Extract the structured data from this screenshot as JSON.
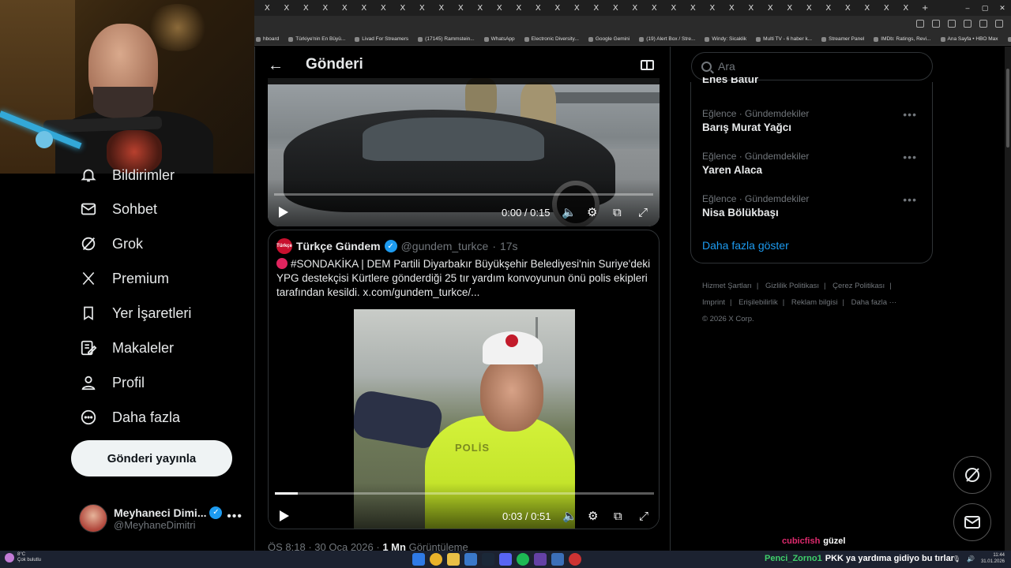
{
  "browser": {
    "tab_close_glyph": "X",
    "tab_count": 34,
    "window_controls": [
      "–",
      "▢",
      "✕"
    ],
    "new_tab": "+",
    "bookmarks": [
      "hboard",
      "Türkiye'nin En Büyü...",
      "Livad For Streamers",
      "(17145) Rammstein...",
      "WhatsApp",
      "Electronic Diversity...",
      "Google Gemini",
      "(19) Alert Box / Stre...",
      "Windy: Sicaklik",
      "Multi TV - 6 haber k...",
      "Streamer Panel",
      "IMDb: Ratings, Revi...",
      "Ana Sayfa • HBO Max",
      "»",
      "Tüm Yer İşaretleri"
    ]
  },
  "nav": {
    "items": [
      {
        "label": "Bildirimler",
        "icon": "bell-icon"
      },
      {
        "label": "Sohbet",
        "icon": "mail-icon"
      },
      {
        "label": "Grok",
        "icon": "grok-icon"
      },
      {
        "label": "Premium",
        "icon": "x-logo-icon"
      },
      {
        "label": "Yer İşaretleri",
        "icon": "bookmark-icon"
      },
      {
        "label": "Makaleler",
        "icon": "article-icon"
      },
      {
        "label": "Profil",
        "icon": "person-icon"
      },
      {
        "label": "Daha fazla",
        "icon": "more-circle-icon"
      }
    ],
    "post_button": "Gönderi yayınla",
    "profile": {
      "name": "Meyhaneci Dimi...",
      "handle": "@MeyhaneDimitri",
      "more": "•••",
      "avatar_label": "DİMİTRİ"
    }
  },
  "post": {
    "header_title": "Gönderi",
    "video1": {
      "time": "0:00 / 0:15",
      "progress": 0.0
    },
    "quote": {
      "avatar_label": "Türkçe",
      "name": "Türkçe Gündem",
      "handle": "@gundem_turkce",
      "dot": "·",
      "age": "17s",
      "text": "#SONDAKİKA | DEM Partili Diyarbakır Büyükşehir Belediyesi'nin Suriye'deki YPG destekçisi Kürtlere gönderdiği 25 tır yardım konvoyunun önü polis ekipleri tarafından kesildi.  x.com/gundem_turkce/...",
      "video_time": "0:03 / 0:51",
      "video_progress": 0.06,
      "video_overlay_text": "POLİS"
    },
    "meta": {
      "time": "ÖS 8:18",
      "sep": "·",
      "date": "30 Oca 2026",
      "views": "1 Mn",
      "views_label": "Görüntüleme"
    }
  },
  "sidebar": {
    "search_placeholder": "Ara",
    "partial_trend": "Enes Batur",
    "trends": [
      {
        "category": "Eğlence · Gündemdekiler",
        "name": "Barış Murat Yağcı"
      },
      {
        "category": "Eğlence · Gündemdekiler",
        "name": "Yaren Alaca"
      },
      {
        "category": "Eğlence · Gündemdekiler",
        "name": "Nisa Bölükbaşı"
      }
    ],
    "trend_more": "•••",
    "show_more": "Daha fazla göster",
    "footer": [
      "Hizmet Şartları",
      "Gizlilik Politikası",
      "Çerez Politikası",
      "Imprint",
      "Erişilebilirlik",
      "Reklam bilgisi",
      "Daha fazla ···",
      "© 2026 X Corp."
    ]
  },
  "stream_chat": [
    {
      "user": "cubicfish",
      "message": "güzel"
    },
    {
      "user": "Penci_Zorno1",
      "message": "PKK ya yardıma gidiyo bu tırlar"
    }
  ],
  "taskbar": {
    "weather_temp": "8°C",
    "weather_desc": "Çok bulutlu",
    "clock_time": "11:44",
    "clock_date": "31.01.2026"
  },
  "colors": {
    "accent": "#1d9bf0",
    "background": "#000000",
    "text": "#e7e9ea",
    "muted": "#71767b",
    "border": "#2f3336",
    "chat_user1": "#e02a6e",
    "chat_user2": "#3fd06b"
  }
}
